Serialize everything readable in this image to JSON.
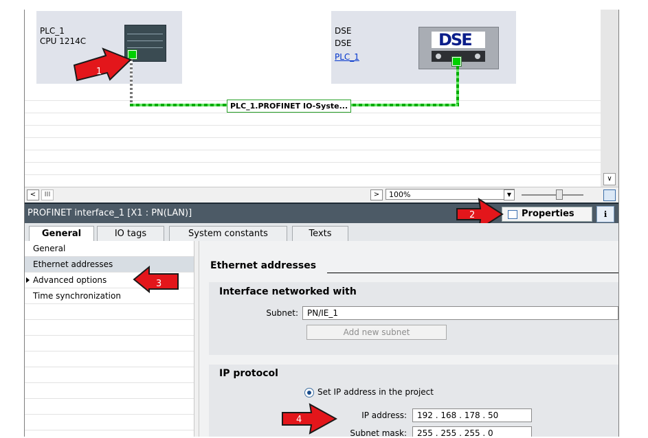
{
  "devices": {
    "plc": {
      "name": "PLC_1",
      "type": "CPU 1214C"
    },
    "dse": {
      "name": "DSE",
      "type": "DSE",
      "link": "PLC_1",
      "logo": "DSE"
    }
  },
  "network": {
    "label": "PLC_1.PROFINET IO-Syste..."
  },
  "toolbar": {
    "zoom": "100%",
    "scroll_left_icon": "<",
    "scroll_right_icon": ">",
    "scroll_thumb": "III"
  },
  "inspector": {
    "title": "PROFINET interface_1 [X1 : PN(LAN)]",
    "properties_label": "Properties",
    "tabs": [
      "General",
      "IO tags",
      "System constants",
      "Texts"
    ],
    "nav": [
      "General",
      "Ethernet addresses",
      "Advanced options",
      "Time synchronization"
    ]
  },
  "ethernet": {
    "section_title": "Ethernet addresses",
    "networked_title": "Interface networked with",
    "subnet_label": "Subnet:",
    "subnet_value": "PN/IE_1",
    "add_subnet_label": "Add new subnet",
    "ip_title": "IP protocol",
    "set_ip_label": "Set IP address in the project",
    "ip_label": "IP address:",
    "ip_value": "192 . 168 . 178 . 50",
    "mask_label": "Subnet mask:",
    "mask_value": "255 . 255 . 255 . 0"
  },
  "callouts": [
    "1",
    "2",
    "3",
    "4"
  ],
  "colors": {
    "callout_red": "#e3161b",
    "accent_green": "#00d000",
    "title_bar": "#4c5a66"
  }
}
